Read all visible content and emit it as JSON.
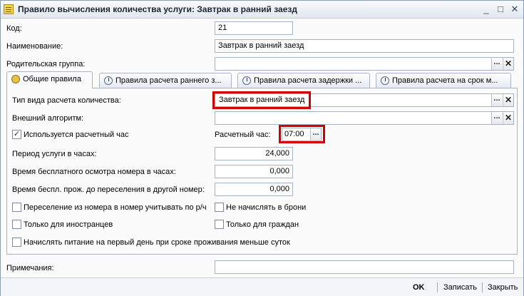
{
  "window": {
    "title": "Правило вычисления количества услуги: Завтрак в ранний заезд",
    "controls": {
      "minimize": "_",
      "maximize": "□",
      "close": "✕"
    }
  },
  "header": {
    "code_label": "Код:",
    "code_value": "21",
    "name_label": "Наименование:",
    "name_value": "Завтрак в ранний заезд",
    "parent_label": "Родительская группа:",
    "parent_value": ""
  },
  "tabs": [
    {
      "label": "Общие правила",
      "icon": "coins-icon"
    },
    {
      "label": "Правила расчета раннего з...",
      "icon": "clock-icon"
    },
    {
      "label": "Правила расчета задержки ...",
      "icon": "clock-icon"
    },
    {
      "label": "Правила расчета на срок м...",
      "icon": "clock-icon"
    }
  ],
  "general": {
    "calc_type_label": "Тип вида расчета количества:",
    "calc_type_value": "Завтрак в ранний заезд",
    "ext_algo_label": "Внешний алгоритм:",
    "ext_algo_value": "",
    "use_calc_hour_label": "Используется расчетный час",
    "use_calc_hour_checked": true,
    "calc_hour_label": "Расчетный час:",
    "calc_hour_value": "07:00",
    "period_label": "Период услуги в часах:",
    "period_value": "24,000",
    "free_inspection_label": "Время бесплатного осмотра номера в часах:",
    "free_inspection_value": "0,000",
    "free_stay_label": "Время беспл. прож. до переселения в другой номер:",
    "free_stay_value": "0,000",
    "checkboxes": [
      {
        "label": "Переселение из номера в номер учитывать по р/ч",
        "checked": false
      },
      {
        "label": "Не начислять в брони",
        "checked": false
      },
      {
        "label": "Только для иностранцев",
        "checked": false
      },
      {
        "label": "Только для граждан",
        "checked": false
      },
      {
        "label": "Начислять питание на первый день при сроке проживания меньше суток",
        "checked": false
      }
    ],
    "ellipsis": "...",
    "clear": "✕"
  },
  "notes": {
    "label": "Примечания:",
    "value": ""
  },
  "footer": {
    "ok": "OK",
    "save": "Записать",
    "close": "Закрыть"
  }
}
